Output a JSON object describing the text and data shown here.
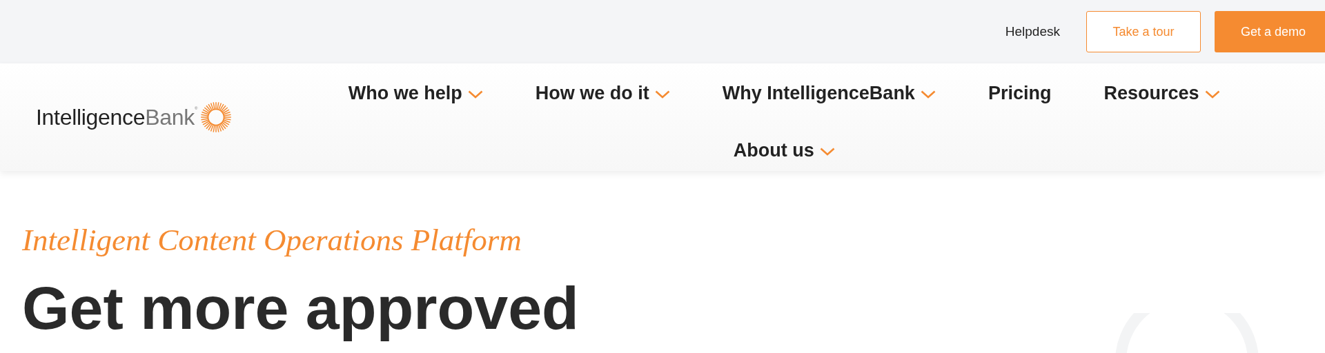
{
  "top_bar": {
    "helpdesk": "Helpdesk",
    "buttons": [
      {
        "label": "Take a tour",
        "kind": "outline"
      },
      {
        "label": "Get a demo",
        "kind": "filled"
      }
    ]
  },
  "logo": {
    "dark": "Intelligence",
    "light": "Bank",
    "mark": "®"
  },
  "nav": [
    {
      "label": "Who we help",
      "dropdown": true
    },
    {
      "label": "How we do it",
      "dropdown": true
    },
    {
      "label": "Why IntelligenceBank",
      "dropdown": true
    },
    {
      "label": "Pricing",
      "dropdown": false
    },
    {
      "label": "Resources",
      "dropdown": true
    },
    {
      "label": "About us",
      "dropdown": true
    }
  ],
  "hero": {
    "tagline": "Intelligent Content Operations Platform",
    "heading": "Get more approved"
  }
}
